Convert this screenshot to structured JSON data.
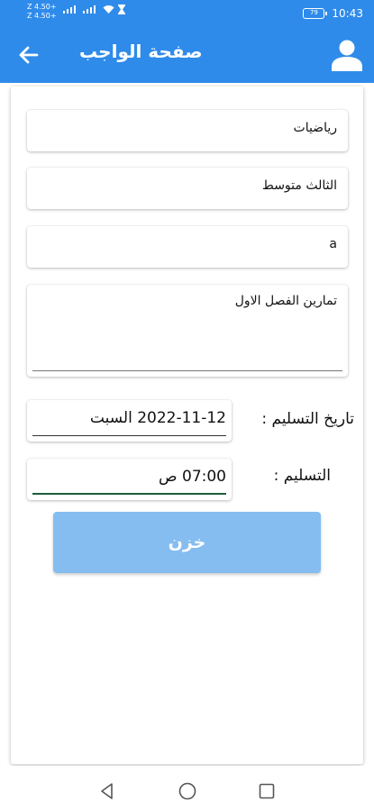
{
  "status_bar": {
    "carrier_1": "Z 4.50+",
    "carrier_2": "Z 4.50+",
    "battery": "79",
    "time": "10:43"
  },
  "app_bar": {
    "title": "صفحة الواجب",
    "back_icon": "arrow-left-icon",
    "profile_icon": "person-icon"
  },
  "form": {
    "subject": "رياضيات",
    "grade": "الثالث متوسط",
    "section": "a",
    "description": "تمارين الفصل الاول",
    "due_date_label": "تاريخ التسليم :",
    "due_date_value": "2022-11-12 السبت",
    "due_time_label": "التسليم :",
    "due_time_value": "07:00 ص",
    "save_label": "خزن"
  },
  "colors": {
    "primary": "#2f8bea",
    "button_disabled": "#85bdf0",
    "underline_active": "#1b5e3c"
  },
  "nav_bar": {
    "back": "triangle-back-icon",
    "home": "circle-home-icon",
    "recents": "square-recents-icon"
  }
}
